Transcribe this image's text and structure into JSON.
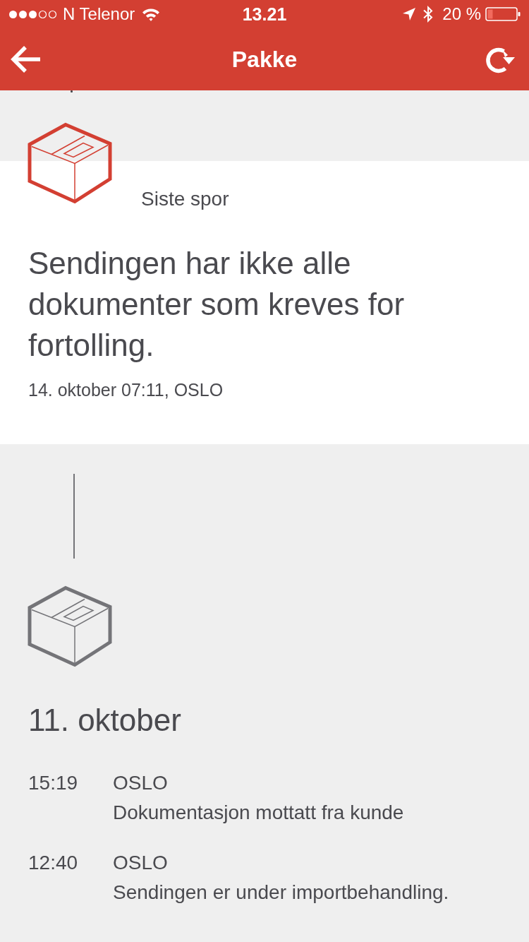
{
  "status_bar": {
    "carrier": "N Telenor",
    "time": "13.21",
    "battery": "20 %"
  },
  "nav": {
    "title": "Pakke"
  },
  "latest": {
    "label": "Siste spor",
    "message": "Sendingen har ikke alle dokumenter som kreves for fortolling.",
    "when": "14. oktober 07:11, OSLO"
  },
  "history": [
    {
      "date": "11. oktober",
      "events": [
        {
          "time": "15:19",
          "place": "OSLO",
          "description": "Dokumentasjon mottatt fra kunde"
        },
        {
          "time": "12:40",
          "place": "OSLO",
          "description": "Sendingen er under importbehandling."
        }
      ]
    }
  ]
}
